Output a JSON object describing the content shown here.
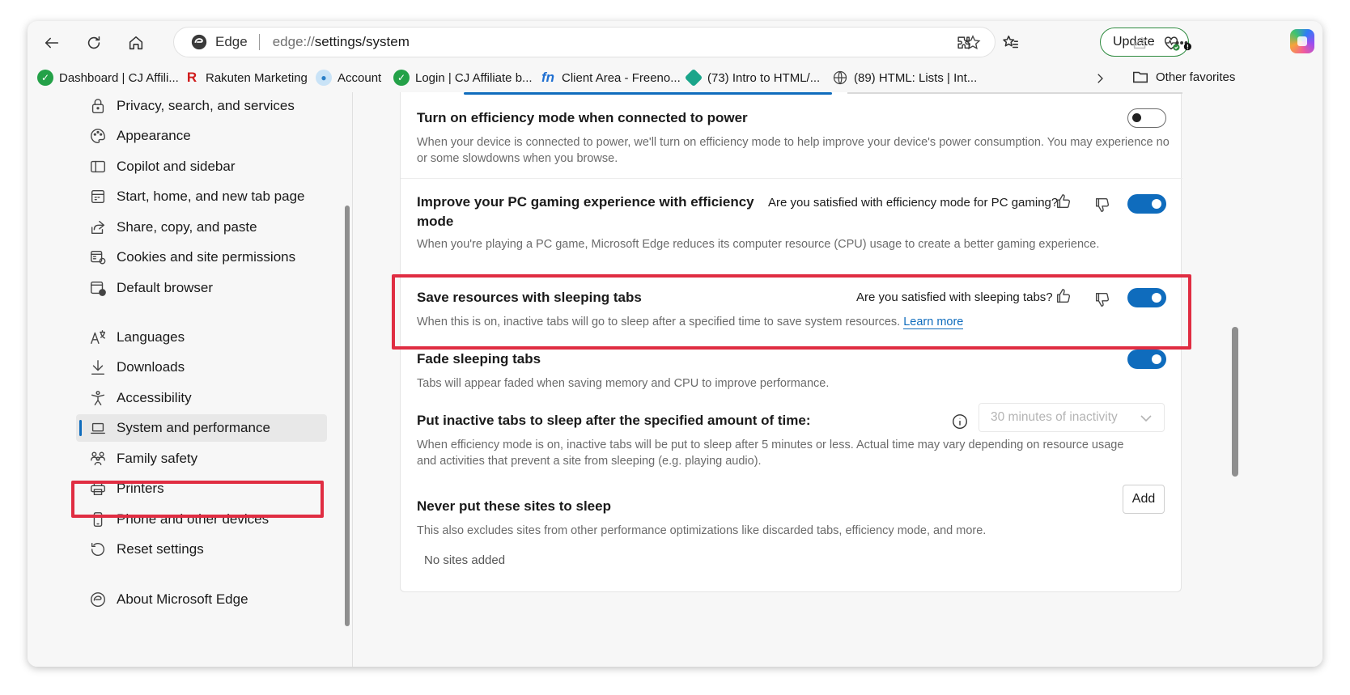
{
  "toolbar": {
    "address_label": "Edge",
    "url_scheme": "edge://",
    "url_path": "settings/system",
    "update_label": "Update"
  },
  "favorites": {
    "items": [
      {
        "label": "Dashboard | CJ Affili...",
        "icon": "cj-affiliate-icon"
      },
      {
        "label": "Rakuten Marketing",
        "icon": "rakuten-icon"
      },
      {
        "label": "Account",
        "icon": "account-icon"
      },
      {
        "label": "Login | CJ Affiliate b...",
        "icon": "cj-affiliate-icon"
      },
      {
        "label": "Client Area - Freeno...",
        "icon": "freenom-icon"
      },
      {
        "label": "(73) Intro to HTML/...",
        "icon": "course-icon"
      },
      {
        "label": "(89) HTML: Lists | Int...",
        "icon": "globe-icon"
      }
    ],
    "other_label": "Other favorites"
  },
  "sidebar": {
    "items": [
      {
        "label": "Privacy, search, and services",
        "icon": "lock-icon"
      },
      {
        "label": "Appearance",
        "icon": "palette-icon"
      },
      {
        "label": "Copilot and sidebar",
        "icon": "sidebar-icon"
      },
      {
        "label": "Start, home, and new tab page",
        "icon": "home-grid-icon"
      },
      {
        "label": "Share, copy, and paste",
        "icon": "share-icon"
      },
      {
        "label": "Cookies and site permissions",
        "icon": "cookie-icon"
      },
      {
        "label": "Default browser",
        "icon": "default-browser-icon"
      },
      {
        "label": "Languages",
        "icon": "languages-icon"
      },
      {
        "label": "Downloads",
        "icon": "download-icon"
      },
      {
        "label": "Accessibility",
        "icon": "accessibility-icon"
      },
      {
        "label": "System and performance",
        "icon": "laptop-icon"
      },
      {
        "label": "Family safety",
        "icon": "family-icon"
      },
      {
        "label": "Printers",
        "icon": "printer-icon"
      },
      {
        "label": "Phone and other devices",
        "icon": "phone-icon"
      },
      {
        "label": "Reset settings",
        "icon": "reset-icon"
      },
      {
        "label": "About Microsoft Edge",
        "icon": "edge-icon"
      }
    ],
    "active_index": 10
  },
  "settings": {
    "efficiency_power": {
      "title": "Turn on efficiency mode when connected to power",
      "desc": "When your device is connected to power, we'll turn on efficiency mode to help improve your device's power consumption. You may experience no or some slowdowns when you browse.",
      "enabled": false
    },
    "gaming": {
      "title_line1": "Improve your PC gaming experience with efficiency",
      "title_line2": "mode",
      "question": "Are you satisfied with efficiency mode for PC gaming?",
      "desc": "When you're playing a PC game, Microsoft Edge reduces its computer resource (CPU) usage to create a better gaming experience.",
      "enabled": true
    },
    "sleeping_tabs": {
      "title": "Save resources with sleeping tabs",
      "question": "Are you satisfied with sleeping tabs?",
      "desc": "When this is on, inactive tabs will go to sleep after a specified time to save system resources.",
      "link": "Learn more",
      "enabled": true
    },
    "fade_tabs": {
      "title": "Fade sleeping tabs",
      "desc": "Tabs will appear faded when saving memory and CPU to improve performance.",
      "enabled": true
    },
    "sleep_timer": {
      "title": "Put inactive tabs to sleep after the specified amount of time:",
      "selected": "30 minutes of inactivity",
      "desc": "When efficiency mode is on, inactive tabs will be put to sleep after 5 minutes or less. Actual time may vary depending on resource usage and activities that prevent a site from sleeping (e.g. playing audio)."
    },
    "never_sleep": {
      "title": "Never put these sites to sleep",
      "add_label": "Add",
      "desc": "This also excludes sites from other performance optimizations like discarded tabs, efficiency mode, and more.",
      "empty": "No sites added"
    }
  },
  "colors": {
    "accent": "#0f6cbd",
    "highlight": "#e02d42",
    "update_border": "#2e8b3f"
  }
}
